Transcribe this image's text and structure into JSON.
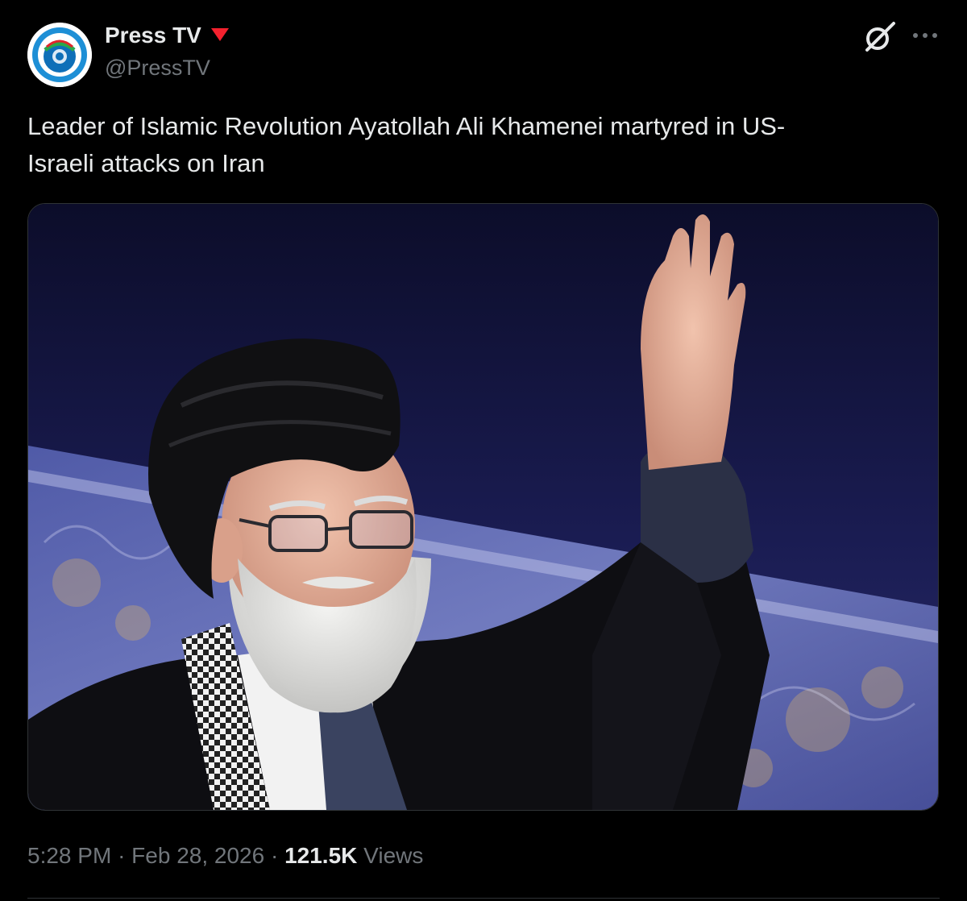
{
  "author": {
    "display_name": "Press TV",
    "handle": "@PressTV",
    "verified_badge_color": "#f4212e",
    "avatar_icon": "presstv-logo-icon"
  },
  "actions": {
    "grok_icon": "grok-icon",
    "more_icon": "more-icon"
  },
  "tweet": {
    "text_line_1": "Leader of Islamic Revolution Ayatollah Ali Khamenei martyred in US-",
    "text_line_2": "Israeli attacks on Iran"
  },
  "media": {
    "type": "photo"
  },
  "meta": {
    "time": "5:28 PM",
    "separator_1": "·",
    "date": "Feb 28, 2026",
    "separator_2": "·",
    "views_count": "121.5K",
    "views_label": "Views"
  },
  "colors": {
    "background": "#000000",
    "text_primary": "#e7e9ea",
    "text_secondary": "#71767b",
    "border": "#2f3336"
  }
}
